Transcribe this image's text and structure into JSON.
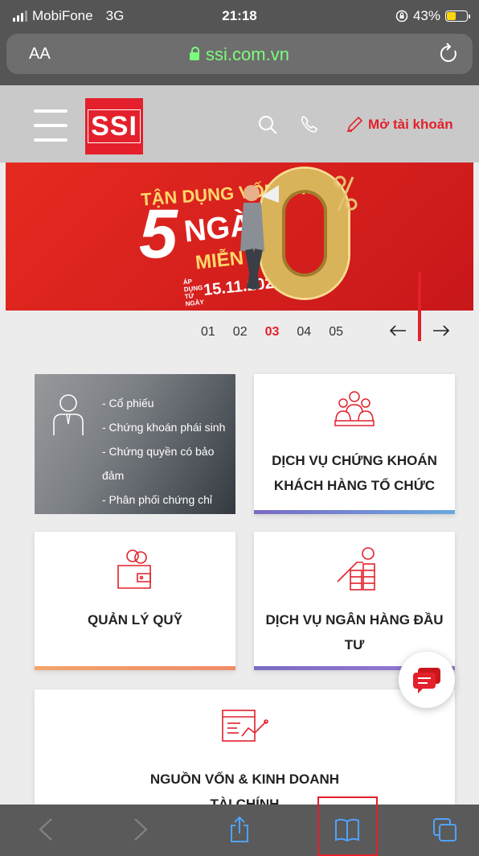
{
  "status_bar": {
    "carrier": "MobiFone",
    "network": "3G",
    "time": "21:18",
    "battery": "43%"
  },
  "browser": {
    "text_size": "AA",
    "url": "ssi.com.vn"
  },
  "header": {
    "logo": "SSI",
    "open_account": "Mở tài khoản"
  },
  "banner": {
    "line1": "TẬN DỤNG VỐN VAY",
    "number": "5",
    "unit": "NGÀY",
    "free": "MIỄN LÃI",
    "date_label": "ÁP DỤNG TỪ NGÀY",
    "date": "15.11.2021",
    "big_value": "0",
    "percent": "%"
  },
  "pager": {
    "pages": [
      "01",
      "02",
      "03",
      "04",
      "05"
    ],
    "active": "03"
  },
  "cards": {
    "brokerage_list": [
      "- Cổ phiếu",
      "- Chứng khoán phái sinh",
      "- Chứng quyền có bảo",
      "đảm",
      "- Phân phối chứng chỉ"
    ],
    "institutional": {
      "line1": "DỊCH VỤ CHỨNG KHOÁN",
      "line2": "KHÁCH HÀNG TỔ CHỨC"
    },
    "fund": "QUẢN LÝ QUỸ",
    "investment_banking": "DỊCH VỤ NGÂN HÀNG ĐẦU TƯ",
    "capital": {
      "line1": "NGUỒN VỐN & KINH DOANH",
      "line2": "TÀI CHÍNH"
    }
  },
  "colors": {
    "brand_red": "#e3202b",
    "bar_blue": "#6aa8e0",
    "bar_orange": "#f2a56a",
    "bar_purple": "#7a6bc4"
  }
}
